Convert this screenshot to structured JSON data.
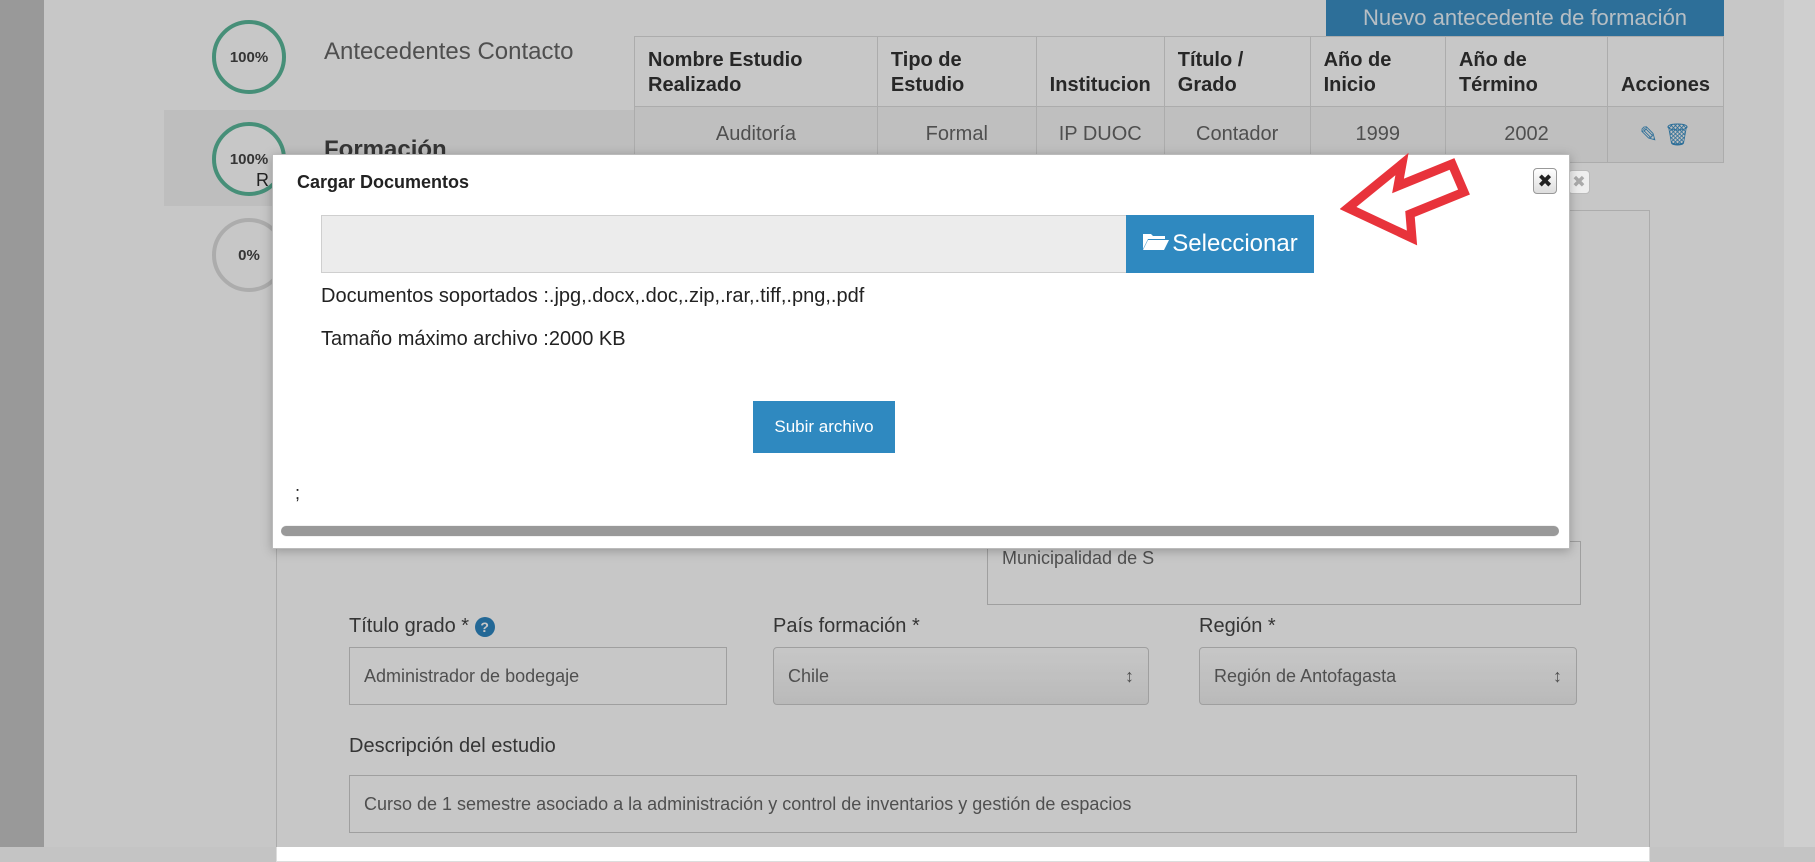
{
  "steps": [
    {
      "percent": "100%",
      "label": "Antecedentes Contacto"
    },
    {
      "percent": "100%",
      "label": "Formación"
    },
    {
      "percent": "0%",
      "label": ""
    }
  ],
  "table": {
    "new_button": "Nuevo antecedente de formación",
    "headers": [
      "Nombre Estudio Realizado",
      "Tipo de Estudio",
      "Institucion",
      "Título / Grado",
      "Año de Inicio",
      "Año de Término",
      "Acciones"
    ],
    "row": [
      "Auditoría",
      "Formal",
      "IP DUOC",
      "Contador",
      "1999",
      "2002"
    ]
  },
  "form": {
    "titulo_label": "Título grado *",
    "titulo_value": "Administrador de bodegaje",
    "pais_label": "País formación *",
    "pais_value": "Chile",
    "region_label": "Región *",
    "region_value": "Región de Antofagasta",
    "institucion_partial": "Municipalidad de S",
    "descripcion_label": "Descripción del estudio",
    "descripcion_value": "Curso de 1 semestre asociado a la administración y control de inventarios y gestión de espacios"
  },
  "back_modal": {
    "partial_title": "R"
  },
  "modal": {
    "title": "Cargar Documentos",
    "select_button": "Seleccionar",
    "supported": "Documentos soportados :.jpg,.docx,.doc,.zip,.rar,.tiff,.png,.pdf",
    "max_size": "Tamaño máximo archivo :2000 KB",
    "upload_button": "Subir archivo",
    "footer": ";"
  },
  "icons": {
    "close": "close-icon",
    "folder": "folder-open-icon",
    "edit": "edit-icon",
    "delete": "trash-icon",
    "help": "help-icon",
    "arrow": "red-arrow-annotation"
  },
  "colors": {
    "primary": "#2f89c0",
    "progress": "#5ab89a",
    "arrow": "#e8333b"
  }
}
